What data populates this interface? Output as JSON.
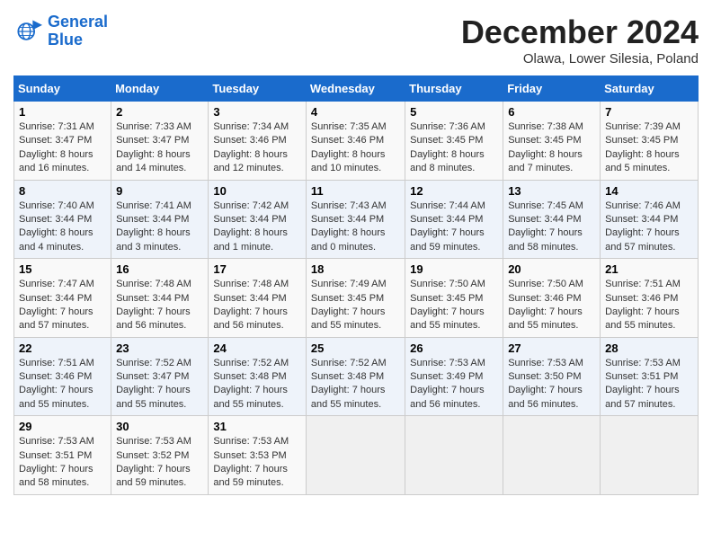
{
  "header": {
    "logo_line1": "General",
    "logo_line2": "Blue",
    "month": "December 2024",
    "location": "Olawa, Lower Silesia, Poland"
  },
  "weekdays": [
    "Sunday",
    "Monday",
    "Tuesday",
    "Wednesday",
    "Thursday",
    "Friday",
    "Saturday"
  ],
  "weeks": [
    [
      {
        "day": "1",
        "text": "Sunrise: 7:31 AM\nSunset: 3:47 PM\nDaylight: 8 hours and 16 minutes."
      },
      {
        "day": "2",
        "text": "Sunrise: 7:33 AM\nSunset: 3:47 PM\nDaylight: 8 hours and 14 minutes."
      },
      {
        "day": "3",
        "text": "Sunrise: 7:34 AM\nSunset: 3:46 PM\nDaylight: 8 hours and 12 minutes."
      },
      {
        "day": "4",
        "text": "Sunrise: 7:35 AM\nSunset: 3:46 PM\nDaylight: 8 hours and 10 minutes."
      },
      {
        "day": "5",
        "text": "Sunrise: 7:36 AM\nSunset: 3:45 PM\nDaylight: 8 hours and 8 minutes."
      },
      {
        "day": "6",
        "text": "Sunrise: 7:38 AM\nSunset: 3:45 PM\nDaylight: 8 hours and 7 minutes."
      },
      {
        "day": "7",
        "text": "Sunrise: 7:39 AM\nSunset: 3:45 PM\nDaylight: 8 hours and 5 minutes."
      }
    ],
    [
      {
        "day": "8",
        "text": "Sunrise: 7:40 AM\nSunset: 3:44 PM\nDaylight: 8 hours and 4 minutes."
      },
      {
        "day": "9",
        "text": "Sunrise: 7:41 AM\nSunset: 3:44 PM\nDaylight: 8 hours and 3 minutes."
      },
      {
        "day": "10",
        "text": "Sunrise: 7:42 AM\nSunset: 3:44 PM\nDaylight: 8 hours and 1 minute."
      },
      {
        "day": "11",
        "text": "Sunrise: 7:43 AM\nSunset: 3:44 PM\nDaylight: 8 hours and 0 minutes."
      },
      {
        "day": "12",
        "text": "Sunrise: 7:44 AM\nSunset: 3:44 PM\nDaylight: 7 hours and 59 minutes."
      },
      {
        "day": "13",
        "text": "Sunrise: 7:45 AM\nSunset: 3:44 PM\nDaylight: 7 hours and 58 minutes."
      },
      {
        "day": "14",
        "text": "Sunrise: 7:46 AM\nSunset: 3:44 PM\nDaylight: 7 hours and 57 minutes."
      }
    ],
    [
      {
        "day": "15",
        "text": "Sunrise: 7:47 AM\nSunset: 3:44 PM\nDaylight: 7 hours and 57 minutes."
      },
      {
        "day": "16",
        "text": "Sunrise: 7:48 AM\nSunset: 3:44 PM\nDaylight: 7 hours and 56 minutes."
      },
      {
        "day": "17",
        "text": "Sunrise: 7:48 AM\nSunset: 3:44 PM\nDaylight: 7 hours and 56 minutes."
      },
      {
        "day": "18",
        "text": "Sunrise: 7:49 AM\nSunset: 3:45 PM\nDaylight: 7 hours and 55 minutes."
      },
      {
        "day": "19",
        "text": "Sunrise: 7:50 AM\nSunset: 3:45 PM\nDaylight: 7 hours and 55 minutes."
      },
      {
        "day": "20",
        "text": "Sunrise: 7:50 AM\nSunset: 3:46 PM\nDaylight: 7 hours and 55 minutes."
      },
      {
        "day": "21",
        "text": "Sunrise: 7:51 AM\nSunset: 3:46 PM\nDaylight: 7 hours and 55 minutes."
      }
    ],
    [
      {
        "day": "22",
        "text": "Sunrise: 7:51 AM\nSunset: 3:46 PM\nDaylight: 7 hours and 55 minutes."
      },
      {
        "day": "23",
        "text": "Sunrise: 7:52 AM\nSunset: 3:47 PM\nDaylight: 7 hours and 55 minutes."
      },
      {
        "day": "24",
        "text": "Sunrise: 7:52 AM\nSunset: 3:48 PM\nDaylight: 7 hours and 55 minutes."
      },
      {
        "day": "25",
        "text": "Sunrise: 7:52 AM\nSunset: 3:48 PM\nDaylight: 7 hours and 55 minutes."
      },
      {
        "day": "26",
        "text": "Sunrise: 7:53 AM\nSunset: 3:49 PM\nDaylight: 7 hours and 56 minutes."
      },
      {
        "day": "27",
        "text": "Sunrise: 7:53 AM\nSunset: 3:50 PM\nDaylight: 7 hours and 56 minutes."
      },
      {
        "day": "28",
        "text": "Sunrise: 7:53 AM\nSunset: 3:51 PM\nDaylight: 7 hours and 57 minutes."
      }
    ],
    [
      {
        "day": "29",
        "text": "Sunrise: 7:53 AM\nSunset: 3:51 PM\nDaylight: 7 hours and 58 minutes."
      },
      {
        "day": "30",
        "text": "Sunrise: 7:53 AM\nSunset: 3:52 PM\nDaylight: 7 hours and 59 minutes."
      },
      {
        "day": "31",
        "text": "Sunrise: 7:53 AM\nSunset: 3:53 PM\nDaylight: 7 hours and 59 minutes."
      },
      null,
      null,
      null,
      null
    ]
  ]
}
